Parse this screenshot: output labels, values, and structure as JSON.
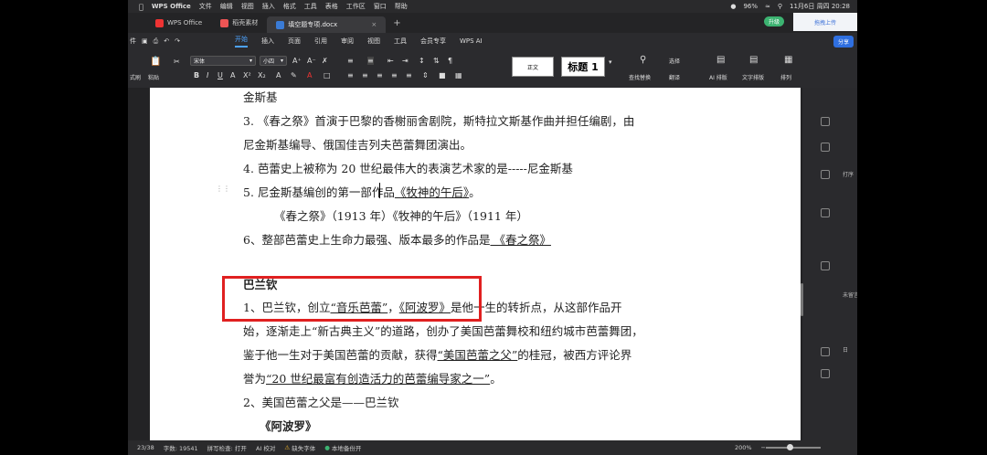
{
  "menubar": {
    "app": "WPS Office",
    "items": [
      "文件",
      "编辑",
      "视图",
      "插入",
      "格式",
      "工具",
      "表格",
      "工作区",
      "窗口",
      "帮助"
    ],
    "battery": "96%",
    "datetime": "11月6日 周四 20:28"
  },
  "tabs": [
    {
      "label": "WPS Office",
      "color": "#e33"
    },
    {
      "label": "稻壳素材",
      "color": "#e55"
    },
    {
      "label": "填空题专项.docx",
      "color": "#3a7bd5"
    }
  ],
  "upgrade_label": "升级",
  "cloud_label": "拖拽上传",
  "ribbon": {
    "file": "件",
    "tabs": [
      "开始",
      "插入",
      "页面",
      "引用",
      "审阅",
      "视图",
      "工具",
      "会员专享",
      "WPS AI"
    ],
    "share": "分享"
  },
  "toolbar": {
    "format_brush": "式刷",
    "paste": "粘贴",
    "font": "宋体",
    "size": "小四",
    "style_normal": "正文",
    "style_heading": "标题 1",
    "find_replace": "查找替换",
    "select": "选择",
    "translate": "翻译",
    "ai_layout": "AI 排版",
    "text_layout": "文字排版",
    "arrange": "排列"
  },
  "document": {
    "lines": [
      {
        "segments": [
          {
            "t": "金斯基"
          }
        ]
      },
      {
        "segments": [
          {
            "t": "3. 《春之祭》首演于巴黎的香榭丽舍剧院，斯特拉文斯基作曲并担任编剧，由"
          }
        ]
      },
      {
        "segments": [
          {
            "t": "尼金斯基编导、俄国佳吉列夫芭蕾舞团演出。"
          }
        ]
      },
      {
        "segments": [
          {
            "t": "4. 芭蕾史上被称为 20 世纪最伟大的表演艺术家的是-----尼金斯基"
          }
        ]
      },
      {
        "segments": [
          {
            "t": "5. 尼金斯基编创的第一部作品"
          },
          {
            "t": "《牧神的午后》",
            "u": true
          },
          {
            "t": "。"
          }
        ]
      },
      {
        "segments": [
          {
            "t": "《春之祭》（1913 年）《牧神的午后》（1911 年）"
          }
        ]
      },
      {
        "segments": [
          {
            "t": "6、整部芭蕾史上生命力最强、版本最多的作品是"
          },
          {
            "t": "     《春之祭》    ",
            "u": true
          }
        ]
      },
      {
        "segments": [
          {
            "t": "巴兰钦",
            "b": true
          }
        ]
      },
      {
        "segments": [
          {
            "t": "1、巴兰钦，创立"
          },
          {
            "t": "“音乐芭蕾”",
            "u": true
          },
          {
            "t": "，"
          },
          {
            "t": "《阿波罗》",
            "u": true
          },
          {
            "t": "是他一生的转折点，从这部作品开"
          }
        ]
      },
      {
        "segments": [
          {
            "t": "始，逐渐走上“新古典主义”的道路，创办了美国芭蕾舞校和纽约城市芭蕾舞团，"
          }
        ]
      },
      {
        "segments": [
          {
            "t": "鉴于他一生对于美国芭蕾的贡献，获得"
          },
          {
            "t": "“美国芭蕾之父”",
            "u": true
          },
          {
            "t": "的桂冠，被西方评论界"
          }
        ]
      },
      {
        "segments": [
          {
            "t": "誉为"
          },
          {
            "t": "“20 世纪最富有创造活力的芭蕾编导家之一”",
            "u": true
          },
          {
            "t": "。"
          }
        ]
      },
      {
        "segments": [
          {
            "t": "2、美国芭蕾之父是——巴兰钦"
          }
        ]
      },
      {
        "segments": [
          {
            "t": "《阿波罗》",
            "b": true
          }
        ]
      }
    ]
  },
  "sidebar": {
    "labels": [
      "打序",
      "未留言",
      "日"
    ]
  },
  "statusbar": {
    "page": "23/38",
    "words": "字数: 19541",
    "spell": "拼写检查: 打开",
    "ai_check": "AI 校对",
    "missing_font": "缺失字体",
    "local_backup": "本地备份开",
    "zoom": "200%"
  }
}
